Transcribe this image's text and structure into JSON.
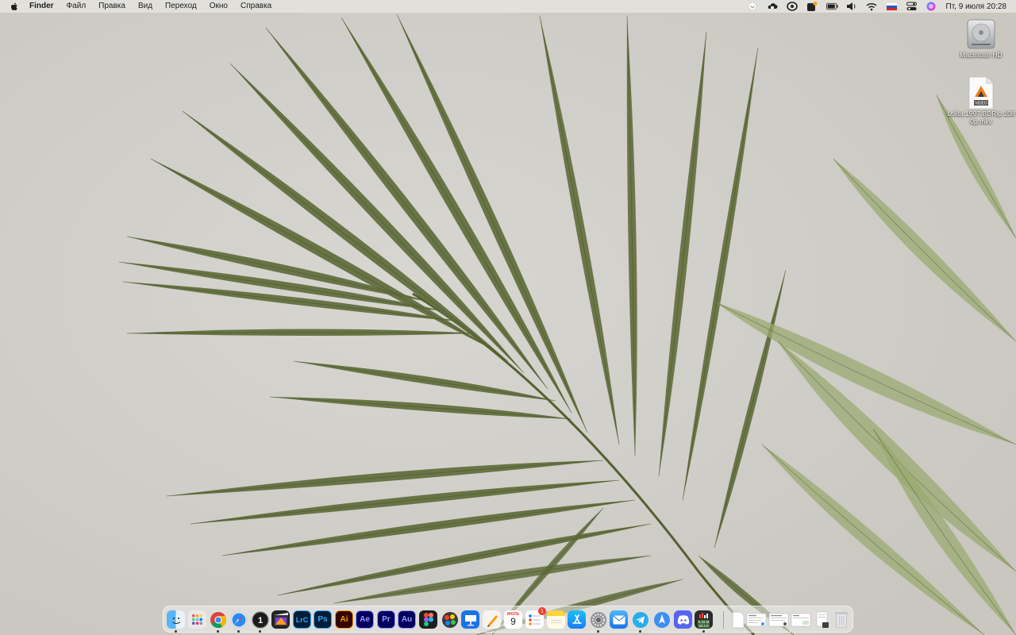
{
  "menubar": {
    "app_name": "Finder",
    "items": [
      "Файл",
      "Правка",
      "Вид",
      "Переход",
      "Окно",
      "Справка"
    ],
    "clock": "Пт, 9 июля  20:28"
  },
  "desktop": {
    "icons": [
      {
        "label": "Macintosh HD",
        "icon": "hard-drive-icon"
      },
      {
        "label": "Lolita.1997.BDRip.1080p.mkv",
        "icon": "video-file-icon",
        "badge": "VIDEO"
      }
    ]
  },
  "dock": {
    "apps": [
      {
        "name": "finder",
        "icon": "finder-icon",
        "running": true
      },
      {
        "name": "launchpad",
        "icon": "launchpad-icon"
      },
      {
        "name": "chrome",
        "icon": "chrome-icon",
        "running": true
      },
      {
        "name": "safari",
        "icon": "safari-icon",
        "running": true
      },
      {
        "name": "capture-one",
        "icon": "capture-one-icon",
        "label": "1",
        "running": true
      },
      {
        "name": "final-cut-pro",
        "icon": "final-cut-pro-icon"
      },
      {
        "name": "lightroom-classic",
        "label": "LrC",
        "icon": "lightroom-icon"
      },
      {
        "name": "photoshop",
        "label": "Ps",
        "icon": "photoshop-icon"
      },
      {
        "name": "illustrator",
        "label": "Ai",
        "icon": "illustrator-icon"
      },
      {
        "name": "after-effects",
        "label": "Ae",
        "icon": "after-effects-icon"
      },
      {
        "name": "premiere-pro",
        "label": "Pr",
        "icon": "premiere-icon"
      },
      {
        "name": "audition",
        "label": "Au",
        "icon": "audition-icon"
      },
      {
        "name": "figma",
        "icon": "figma-icon"
      },
      {
        "name": "pixelmator",
        "icon": "pixelmator-icon"
      },
      {
        "name": "keynote",
        "icon": "keynote-icon"
      },
      {
        "name": "pages",
        "icon": "pages-icon"
      },
      {
        "name": "calendar",
        "icon": "calendar-icon",
        "month": "ИЮЛЬ",
        "day": "9"
      },
      {
        "name": "reminders",
        "icon": "reminders-icon",
        "badge": "1"
      },
      {
        "name": "notes",
        "icon": "notes-icon"
      },
      {
        "name": "app-store",
        "icon": "app-store-icon"
      },
      {
        "name": "system-preferences",
        "icon": "gear-icon",
        "running": true
      },
      {
        "name": "mail",
        "icon": "mail-icon"
      },
      {
        "name": "telegram",
        "icon": "telegram-icon",
        "running": true
      },
      {
        "name": "testflight",
        "icon": "testflight-icon"
      },
      {
        "name": "discord",
        "icon": "discord-icon"
      },
      {
        "name": "istat-menus",
        "icon": "istat-icon",
        "line1": "5.33 M",
        "line2": "18.4 K",
        "running": true
      }
    ],
    "right": [
      {
        "name": "document-stack",
        "icon": "document-icon"
      },
      {
        "name": "screenshot-1",
        "icon": "screenshot-thumb-icon"
      },
      {
        "name": "screenshot-2",
        "icon": "screenshot-thumb-icon"
      },
      {
        "name": "screenshot-3",
        "icon": "screenshot-thumb-icon"
      },
      {
        "name": "documents-folder",
        "icon": "folder-stack-icon"
      },
      {
        "name": "trash",
        "icon": "trash-icon"
      }
    ]
  },
  "colors": {
    "wallpaper_bg": "#d3d1cb",
    "leaf_dark": "#5e6b3a",
    "leaf_light": "#9aaa70"
  }
}
